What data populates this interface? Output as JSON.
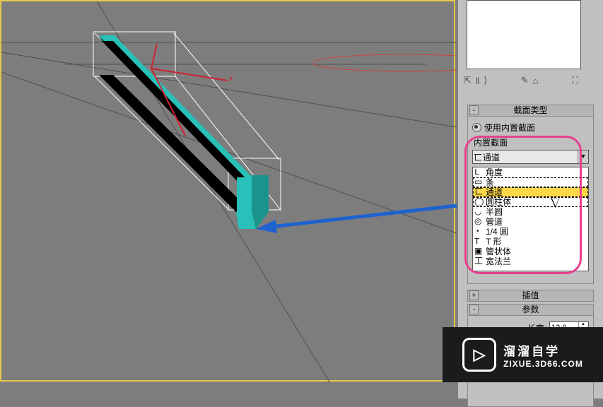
{
  "viewport": {
    "axis_label_x": "x"
  },
  "toolbar_icons": {
    "pin": "⇱",
    "pause": "‖",
    "next": "⟩",
    "wand": "✎",
    "lock": "⌂",
    "opts": "⛶"
  },
  "rollouts": {
    "section_type": {
      "title": "截面类型",
      "radio_builtin": "使用内置截面",
      "group_label": "内置截面",
      "combo_icon": "匸",
      "combo_value": "通道",
      "options": [
        {
          "icon": "L",
          "label": "角度",
          "sel": false,
          "box": false
        },
        {
          "icon": "▭",
          "label": "条",
          "sel": false,
          "box": true
        },
        {
          "icon": "匸",
          "label": "通道",
          "sel": true,
          "box": true
        },
        {
          "icon": "◯",
          "label": "圆柱体",
          "sel": false,
          "box": true
        },
        {
          "icon": "◡",
          "label": "半圆",
          "sel": false,
          "box": false
        },
        {
          "icon": "◎",
          "label": "管道",
          "sel": false,
          "box": false
        },
        {
          "icon": "◔",
          "label": "1/4 圆",
          "sel": false,
          "box": false
        },
        {
          "icon": "T",
          "label": "T 形",
          "sel": false,
          "box": false
        },
        {
          "icon": "▣",
          "label": "管状体",
          "sel": false,
          "box": false
        },
        {
          "icon": "工",
          "label": "宽法兰",
          "sel": false,
          "box": false
        }
      ]
    },
    "interp": {
      "title": "插值"
    },
    "params": {
      "title": "参数",
      "length": {
        "label": "长度:",
        "value": "12.0"
      }
    }
  },
  "watermark": {
    "brand": "溜溜自学",
    "site": "ZIXUE.3D66.COM"
  },
  "callout": {
    "highlight_color": "#e83f8f",
    "arrow_color": "#1e62d0"
  }
}
